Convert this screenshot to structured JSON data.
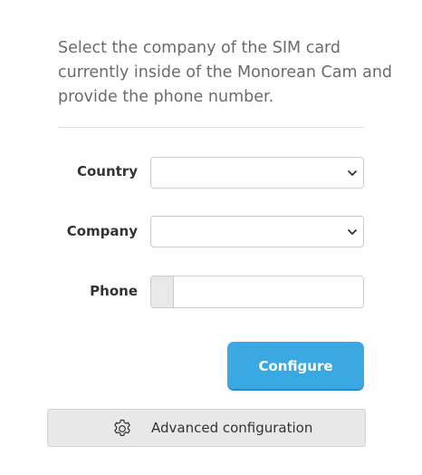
{
  "intro": {
    "text": "Select the company of the SIM card currently inside of the Monorean Cam and provide the phone number."
  },
  "form": {
    "country": {
      "label": "Country",
      "value": ""
    },
    "company": {
      "label": "Company",
      "value": ""
    },
    "phone": {
      "label": "Phone",
      "prefix": "",
      "value": ""
    }
  },
  "buttons": {
    "configure": "Configure",
    "advanced": "Advanced configuration"
  },
  "colors": {
    "primary": "#3aa9e3",
    "secondary_bg": "#e8e8e8",
    "muted_text": "#6b6b6b"
  },
  "icons": {
    "dropdown": "chevron-down-icon",
    "advanced": "gear-icon"
  }
}
